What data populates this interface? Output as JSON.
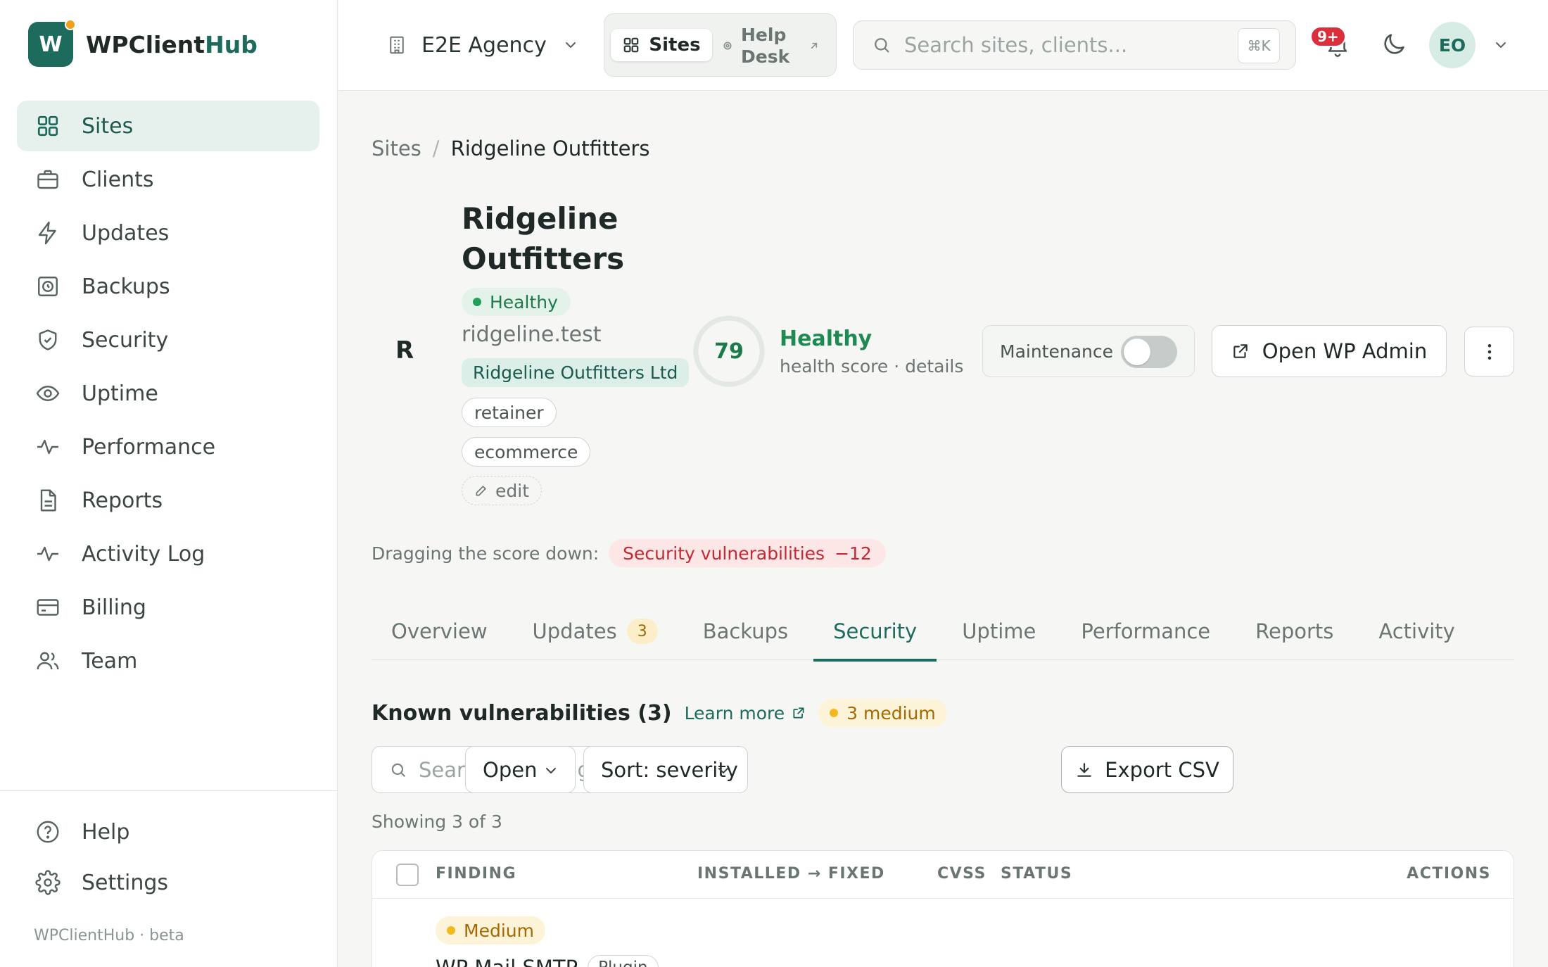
{
  "brand": {
    "logo_letter": "W",
    "name_prefix": "WPClient",
    "name_suffix": "Hub"
  },
  "sidebar": {
    "items": [
      {
        "label": "Sites",
        "icon": "grid-icon",
        "active": true
      },
      {
        "label": "Clients",
        "icon": "briefcase-icon"
      },
      {
        "label": "Updates",
        "icon": "bolt-icon"
      },
      {
        "label": "Backups",
        "icon": "backup-icon"
      },
      {
        "label": "Security",
        "icon": "shield-icon"
      },
      {
        "label": "Uptime",
        "icon": "eye-icon"
      },
      {
        "label": "Performance",
        "icon": "pulse-icon"
      },
      {
        "label": "Reports",
        "icon": "document-icon"
      },
      {
        "label": "Activity Log",
        "icon": "activity-icon"
      },
      {
        "label": "Billing",
        "icon": "card-icon"
      },
      {
        "label": "Team",
        "icon": "team-icon"
      }
    ],
    "bottom": [
      {
        "label": "Help",
        "icon": "help-icon"
      },
      {
        "label": "Settings",
        "icon": "gear-icon"
      }
    ],
    "footer": "WPClientHub · beta"
  },
  "topbar": {
    "workspace": "E2E Agency",
    "switcher": {
      "sites": "Sites",
      "helpdesk": "Help Desk"
    },
    "search_placeholder": "Search sites, clients...",
    "search_shortcut": "⌘K",
    "notifications_badge": "9+",
    "user_initials": "EO"
  },
  "breadcrumb": {
    "root": "Sites",
    "separator": "/",
    "current": "Ridgeline Outfitters"
  },
  "site": {
    "initial": "R",
    "title": "Ridgeline Outfitters",
    "status": "Healthy",
    "domain": "ridgeline.test",
    "client": "Ridgeline Outfitters Ltd",
    "tags": [
      "retainer",
      "ecommerce"
    ],
    "edit_label": "edit",
    "health": {
      "score": 79,
      "max": 100,
      "label": "Healthy",
      "sub": "health score · details"
    },
    "maintenance_label": "Maintenance",
    "maintenance_on": false,
    "open_admin_label": "Open WP Admin"
  },
  "drag": {
    "label": "Dragging the score down:",
    "item": "Security vulnerabilities",
    "delta": "−12"
  },
  "tabs": [
    {
      "label": "Overview"
    },
    {
      "label": "Updates",
      "count": "3"
    },
    {
      "label": "Backups"
    },
    {
      "label": "Security",
      "active": true
    },
    {
      "label": "Uptime"
    },
    {
      "label": "Performance"
    },
    {
      "label": "Reports"
    },
    {
      "label": "Activity"
    }
  ],
  "vulns": {
    "title": "Known vulnerabilities (3)",
    "learn_more": "Learn more",
    "severity_summary": "3 medium",
    "search_placeholder": "Search title, slug, CVE",
    "status_filter": "Open",
    "sort": "Sort: severity",
    "export_label": "Export CSV",
    "showing": "Showing 3 of 3",
    "columns": {
      "finding": "FINDING",
      "installed_fixed": "INSTALLED → FIXED",
      "cvss": "CVSS",
      "status": "STATUS",
      "actions": "ACTIONS"
    },
    "rows": [
      {
        "severity": "Medium",
        "name": "WP Mail SMTP",
        "kind": "Plugin"
      }
    ]
  },
  "colors": {
    "brand": "#1c6b5d",
    "healthy": "#1d8a54",
    "danger": "#c22a34",
    "warning": "#f2b81c"
  }
}
